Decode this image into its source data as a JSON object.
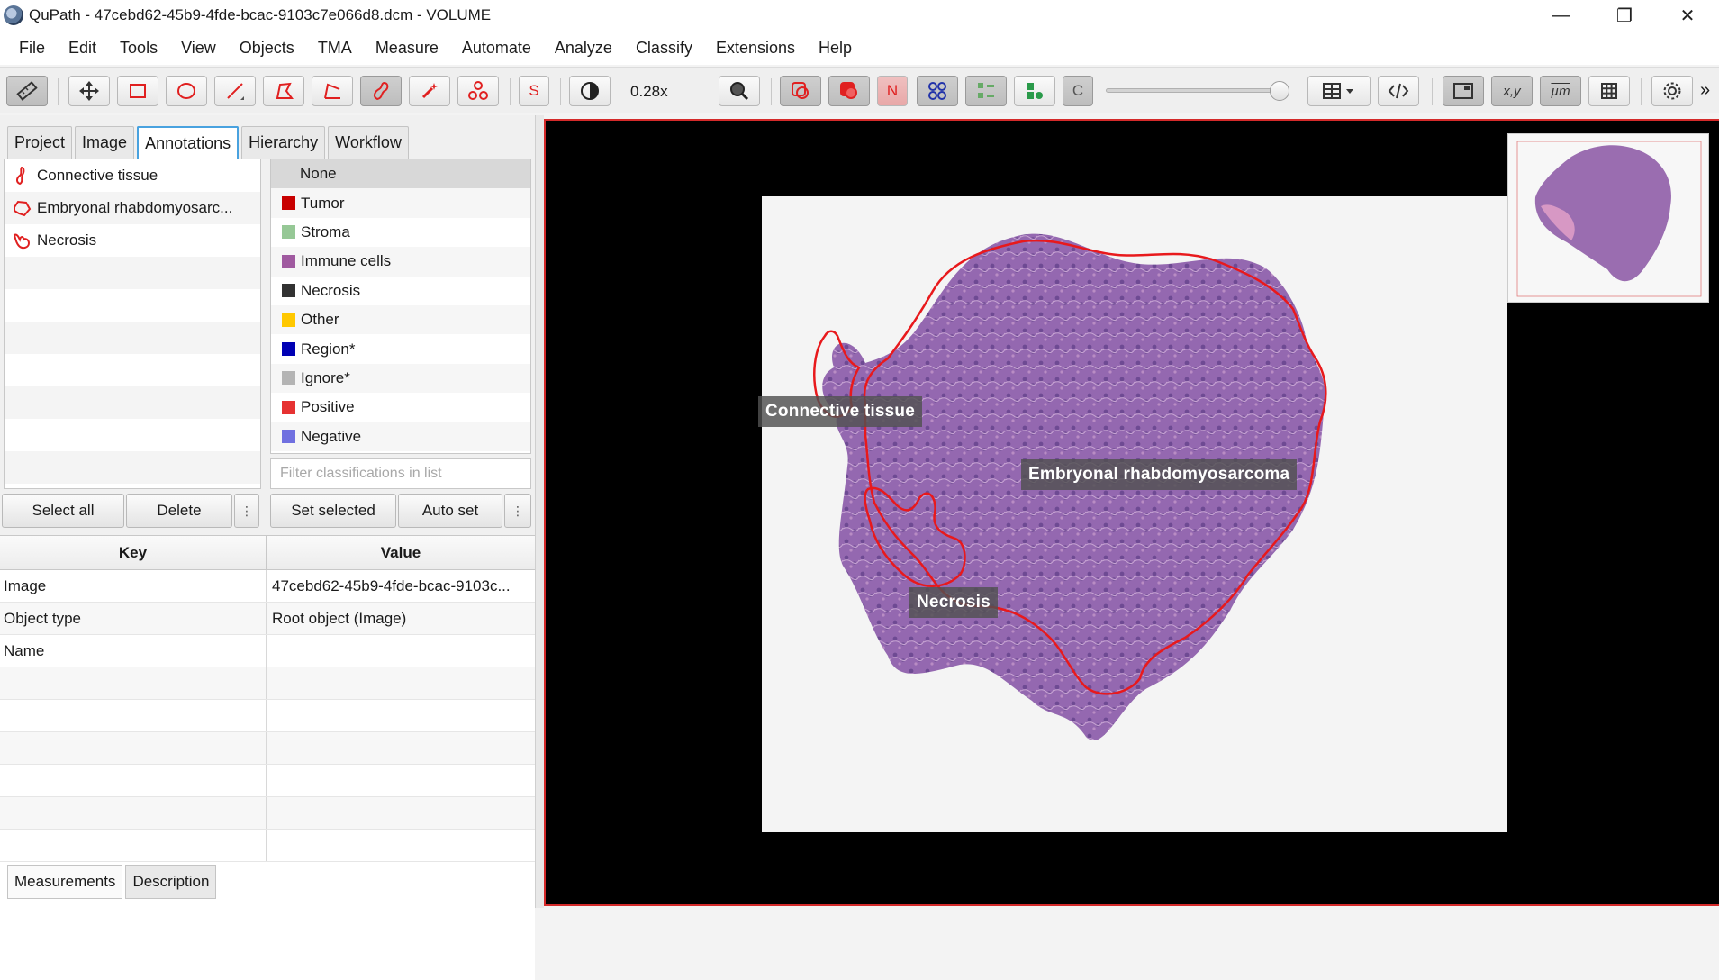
{
  "window": {
    "title": "QuPath - 47cebd62-45b9-4fde-bcac-9103c7e066d8.dcm - VOLUME",
    "minimize": "—",
    "maximize": "❐",
    "close": "✕"
  },
  "menu": [
    "File",
    "Edit",
    "Tools",
    "View",
    "Objects",
    "TMA",
    "Measure",
    "Automate",
    "Analyze",
    "Classify",
    "Extensions",
    "Help"
  ],
  "toolbar": {
    "zoom_label": "0.28x",
    "s_label": "S",
    "n_label": "N",
    "c_label": "C",
    "xy_label": "x,y",
    "um_label": "µm",
    "more_label": "»"
  },
  "left_tabs": [
    "Project",
    "Image",
    "Annotations",
    "Hierarchy",
    "Workflow"
  ],
  "annotations": [
    {
      "name": "Connective tissue",
      "icon": "brush-shape-icon"
    },
    {
      "name": "Embryonal rhabdomyosarc...",
      "icon": "polygon-shape-icon"
    },
    {
      "name": "Necrosis",
      "icon": "freehand-shape-icon"
    }
  ],
  "classes": [
    {
      "name": "None",
      "color": ""
    },
    {
      "name": "Tumor",
      "color": "#c80000"
    },
    {
      "name": "Stroma",
      "color": "#96c896"
    },
    {
      "name": "Immune cells",
      "color": "#a05aa0"
    },
    {
      "name": "Necrosis",
      "color": "#323232"
    },
    {
      "name": "Other",
      "color": "#ffc800"
    },
    {
      "name": "Region*",
      "color": "#0000b4"
    },
    {
      "name": "Ignore*",
      "color": "#b4b4b4"
    },
    {
      "name": "Positive",
      "color": "#e63232"
    },
    {
      "name": "Negative",
      "color": "#7070e0"
    }
  ],
  "filter_placeholder": "Filter classifications in list",
  "buttons": {
    "select_all": "Select all",
    "delete": "Delete",
    "more": "⋮",
    "set_selected": "Set selected",
    "auto_set": "Auto set"
  },
  "props": {
    "key_header": "Key",
    "value_header": "Value",
    "rows": [
      {
        "key": "Image",
        "value": "47cebd62-45b9-4fde-bcac-9103c..."
      },
      {
        "key": "Object type",
        "value": "Root object (Image)"
      },
      {
        "key": "Name",
        "value": ""
      }
    ]
  },
  "bottom_tabs": [
    "Measurements",
    "Description"
  ],
  "viewer_labels": {
    "connective": "Connective tissue",
    "embryonal": "Embryonal rhabdomyosarcoma",
    "necrosis": "Necrosis"
  },
  "colors": {
    "annotation_outline": "#e8191c",
    "tissue": "#9a6db0",
    "accent_tab": "#49a2df"
  }
}
